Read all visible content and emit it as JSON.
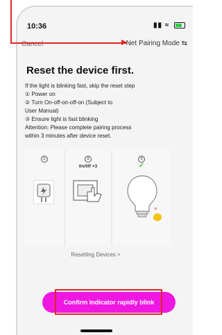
{
  "status_bar": {
    "time": "10:36",
    "icons": "▮▮ ≈"
  },
  "nav": {
    "cancel": "Cancel",
    "mode": "Net Pairing Mode",
    "mode_icon": "⇆"
  },
  "title": "Reset the device first.",
  "instructions": [
    "If the light is blinking fast, skip the reset step",
    "① Power on",
    "② Turn On-off-on-off-on (Subject to",
    "User Manual)",
    "③ Ensure light is fast blinking",
    "Attention: Please complete pairing process",
    "within 3 minutes after device reset."
  ],
  "steps": [
    {
      "num": "①",
      "sub": ""
    },
    {
      "num": "②",
      "sub": "0n/0ff ×3"
    },
    {
      "num": "③",
      "sub": "✓"
    }
  ],
  "link": "Resetting Devices >",
  "button": "Confirm indicator rapidly blink",
  "colors": {
    "accent": "#ee18e2",
    "annotation": "#e0251f",
    "success": "#40c240"
  }
}
